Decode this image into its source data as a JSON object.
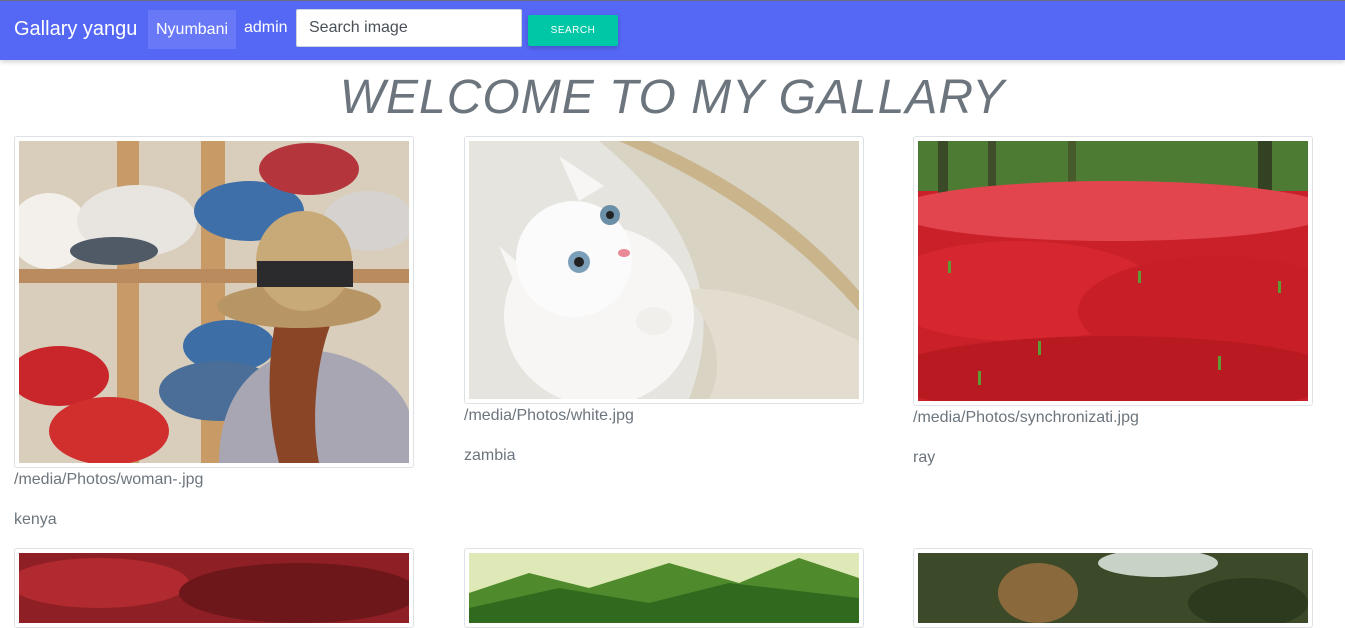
{
  "navbar": {
    "brand": "Gallary yangu",
    "home_label": "Nyumbani",
    "admin_label": "admin",
    "search_placeholder": "Search image",
    "search_button": "SEARCH"
  },
  "page_title": "WELCOME TO MY GALLARY",
  "images": [
    {
      "path": "/media/Photos/woman-.jpg",
      "caption": "kenya",
      "subject": "woman-with-hat-photo"
    },
    {
      "path": "/media/Photos/white.jpg",
      "caption": "zambia",
      "subject": "white-kitten-photo"
    },
    {
      "path": "/media/Photos/synchronizati.jpg",
      "caption": "ray",
      "subject": "red-flower-field-photo"
    },
    {
      "subject": "red-foliage-photo"
    },
    {
      "subject": "green-mountains-photo"
    },
    {
      "subject": "forest-photo"
    }
  ]
}
